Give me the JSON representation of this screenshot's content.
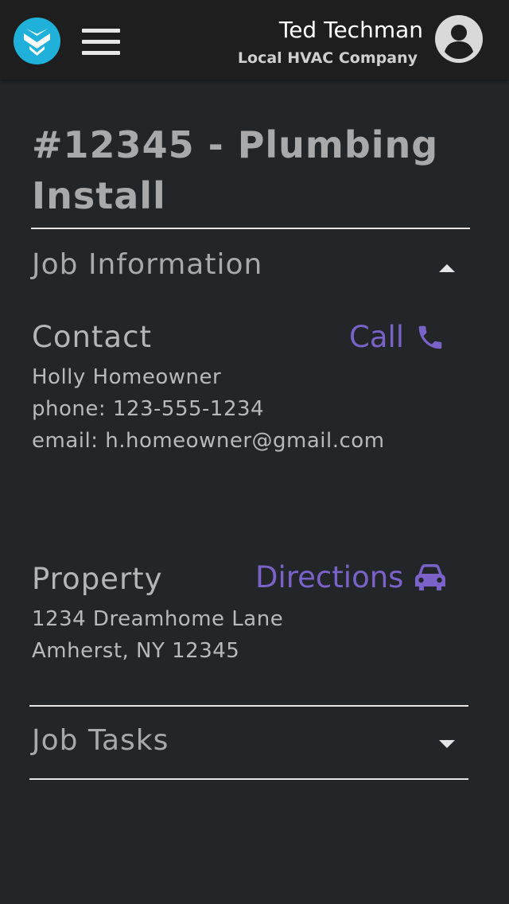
{
  "header": {
    "user_name": "Ted Techman",
    "company": "Local HVAC Company",
    "logo_icon": "logo-icon",
    "menu_icon": "hamburger-menu-icon",
    "avatar_icon": "user-avatar-icon"
  },
  "job": {
    "title": "#12345 - Plumbing Install"
  },
  "sections": {
    "job_information": {
      "title": "Job Information",
      "expanded": true
    },
    "job_tasks": {
      "title": "Job Tasks",
      "expanded": false
    }
  },
  "contact": {
    "title": "Contact",
    "action_label": "Call",
    "action_icon": "phone-icon",
    "name": "Holly Homeowner",
    "phone": "phone: 123-555-1234",
    "email": "email: h.homeowner@gmail.com"
  },
  "property": {
    "title": "Property",
    "action_label": "Directions",
    "action_icon": "car-icon",
    "address_line1": "1234 Dreamhome Lane",
    "address_line2": "Amherst, NY 12345"
  },
  "colors": {
    "accent": "#7a62c8",
    "logo": "#1fb1d9",
    "background": "#222629",
    "topbar": "#1e1e1e"
  }
}
